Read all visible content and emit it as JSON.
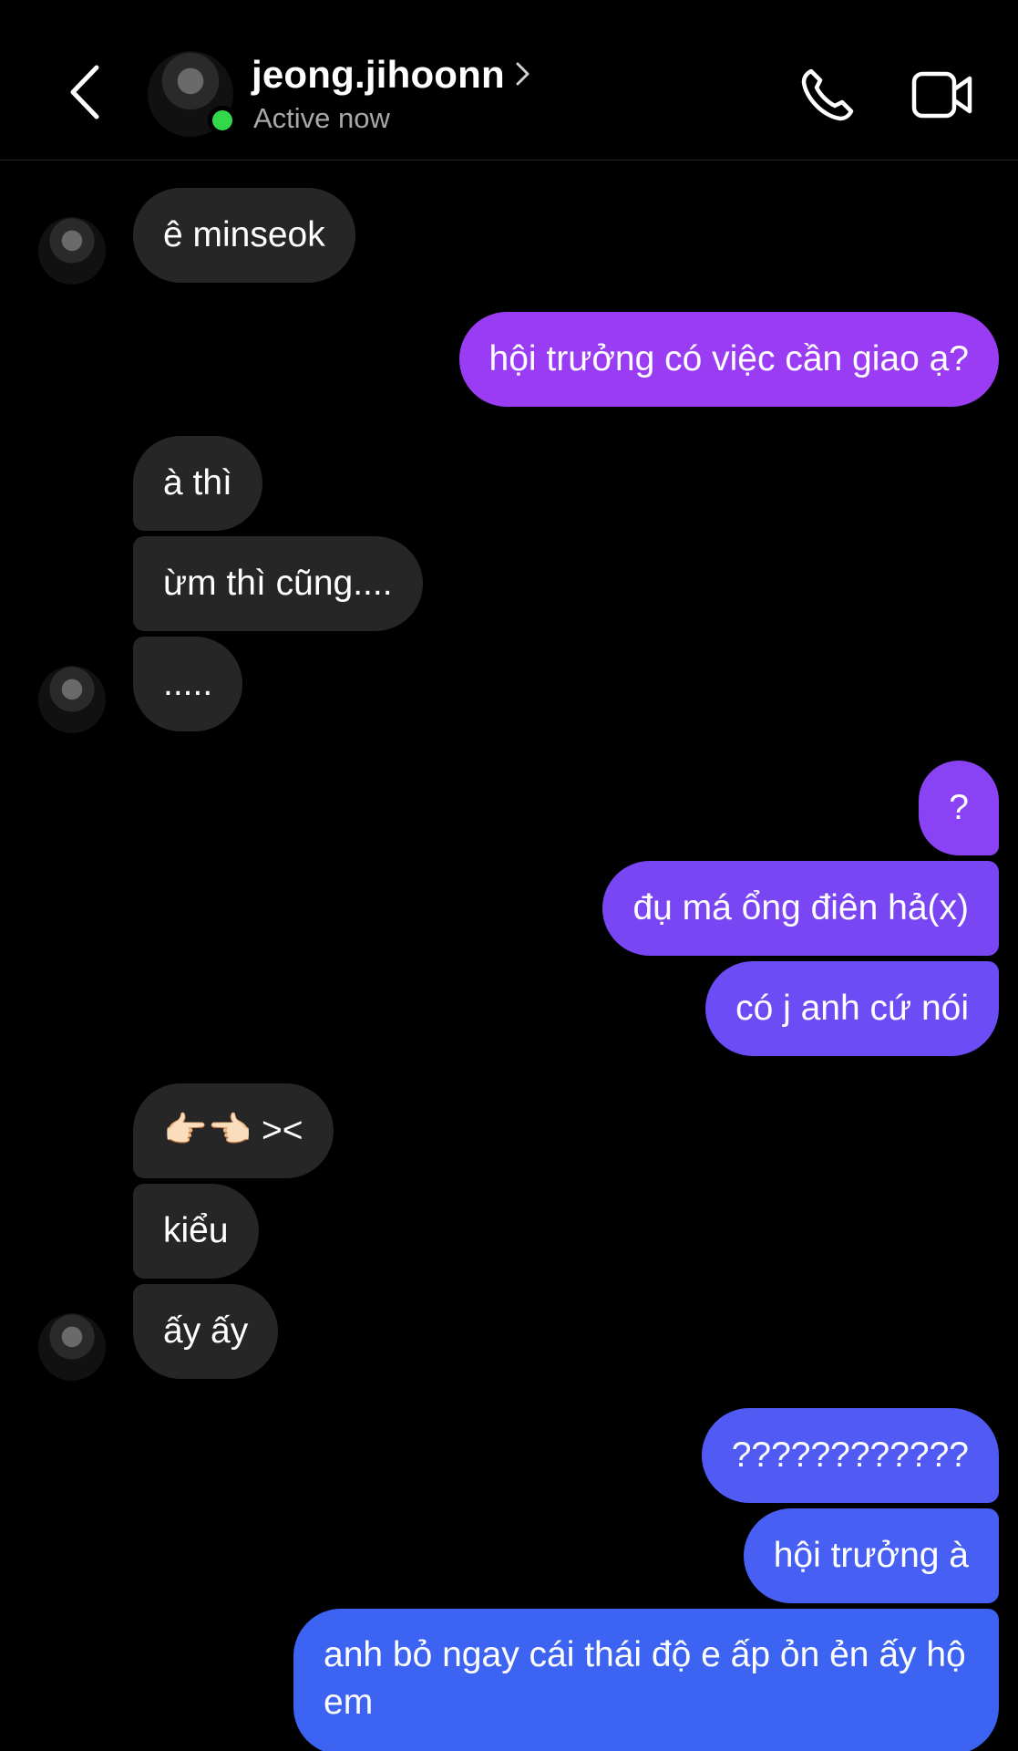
{
  "header": {
    "username": "jeong.jihoonn",
    "status": "Active now"
  },
  "icons": {
    "back": "back-chevron-icon",
    "call": "phone-icon",
    "video": "video-camera-icon"
  },
  "colors": {
    "incoming_bubble": "#262626",
    "outgoing_top": "#9b3cf5",
    "outgoing_bottom": "#3d63f2",
    "online": "#32d74b",
    "status_text": "#a8a8a8"
  },
  "messages": [
    {
      "sender": "them",
      "text": "ê minseok"
    },
    {
      "sender": "me",
      "text": "hội trưởng có việc cần giao ạ?"
    },
    {
      "sender": "them",
      "text": "à thì"
    },
    {
      "sender": "them",
      "text": "ừm thì cũng...."
    },
    {
      "sender": "them",
      "text": "....."
    },
    {
      "sender": "me",
      "text": "?"
    },
    {
      "sender": "me",
      "text": "đụ má ổng điên hả(x)"
    },
    {
      "sender": "me",
      "text": "có j anh cứ nói"
    },
    {
      "sender": "them",
      "text": "👉🏻👈🏻 ><"
    },
    {
      "sender": "them",
      "text": "kiểu"
    },
    {
      "sender": "them",
      "text": "ấy ấy"
    },
    {
      "sender": "me",
      "text": "????????????"
    },
    {
      "sender": "me",
      "text": "hội trưởng à"
    },
    {
      "sender": "me",
      "text": "anh bỏ ngay cái thái độ e ấp ỏn ẻn ấy hộ em"
    }
  ]
}
